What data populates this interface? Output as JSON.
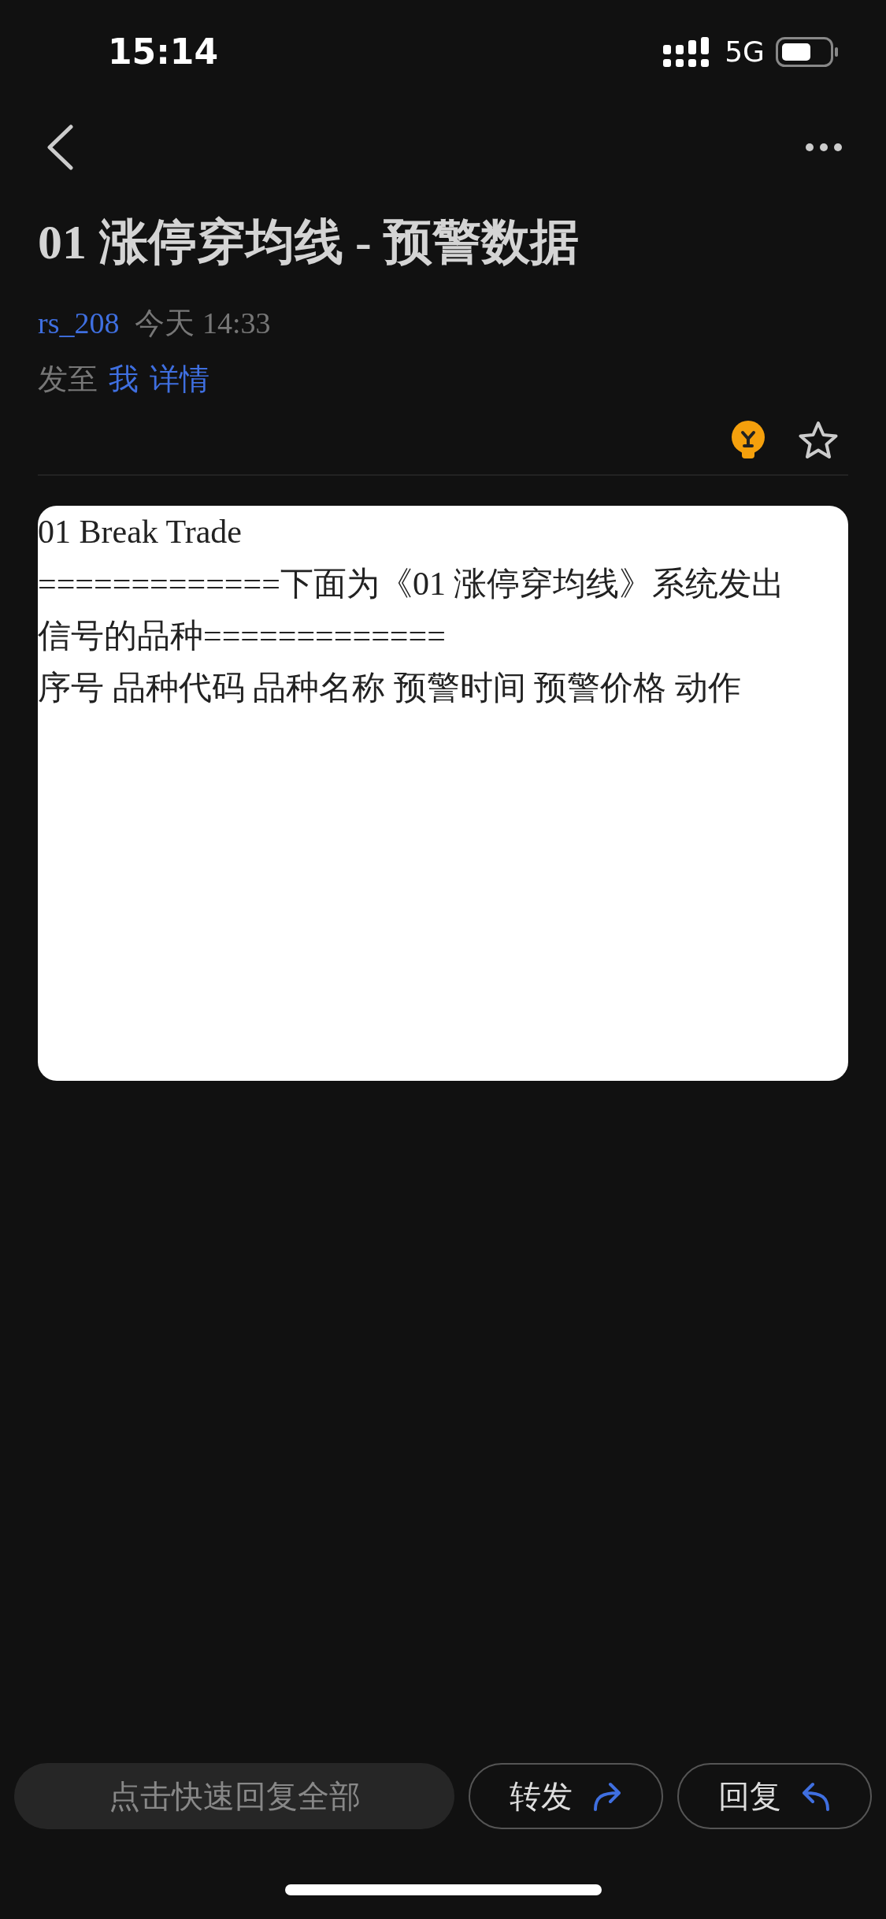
{
  "status_bar": {
    "time": "15:14",
    "network": "5G"
  },
  "message": {
    "title": "01 涨停穿均线 - 预警数据",
    "sender": "rs_208",
    "date": "今天 14:33",
    "to_label": "发至",
    "recipient": "我",
    "details_link": "详情",
    "starred": false
  },
  "body": {
    "lines": [
      "01 Break Trade",
      "=============下面为《01 涨停穿均线》系统发出信号的品种=============",
      "序号 品种代码 品种名称 预警时间 预警价格 动作"
    ]
  },
  "bottom_bar": {
    "quick_reply": {
      "placeholder": "点击快速回复全部"
    },
    "forward": "转发",
    "reply": "回复"
  }
}
